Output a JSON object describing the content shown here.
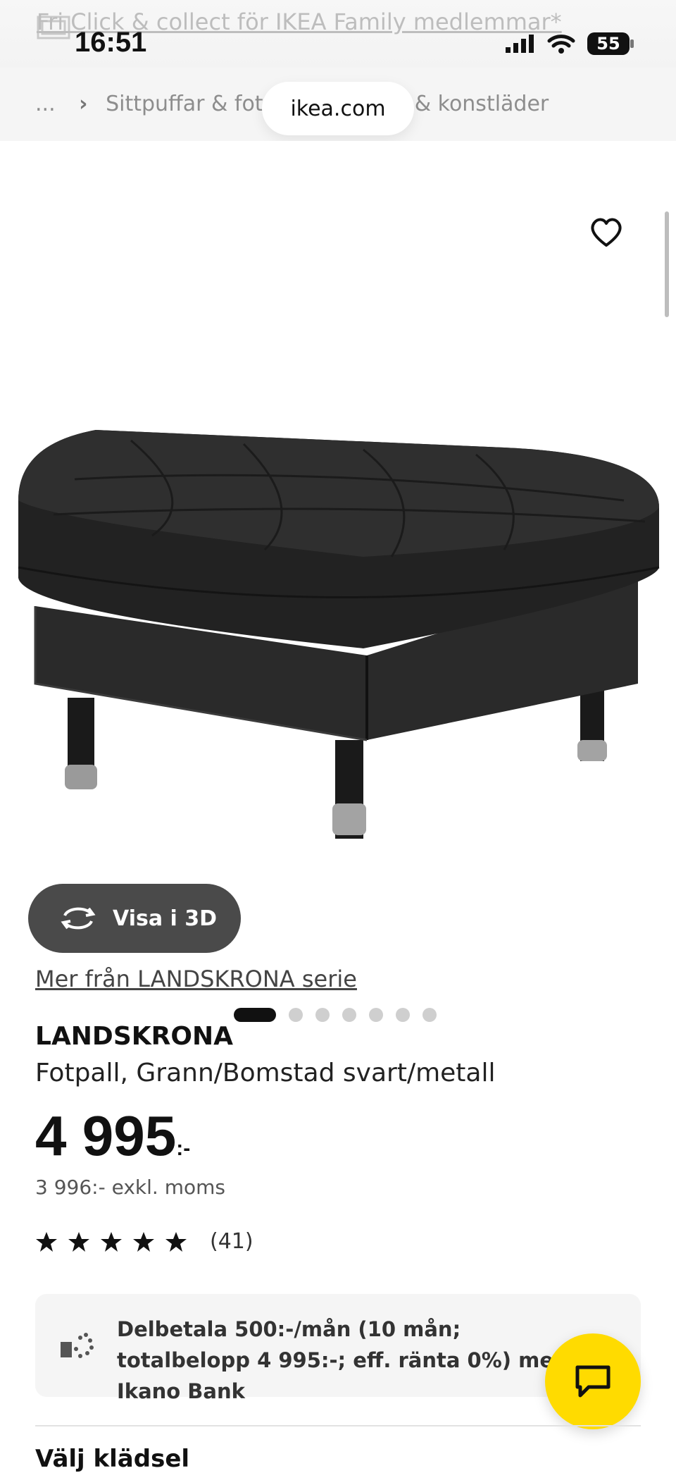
{
  "status_bar": {
    "time": "16:51",
    "battery": "55"
  },
  "promo": {
    "text": "Fri Click & collect för IKEA Family medlemmar*"
  },
  "browser": {
    "url": "ikea.com"
  },
  "breadcrumb": {
    "ellipsis": "...",
    "parent": "Sittpuffar & fotpallar",
    "current": "i skinn & konstläder"
  },
  "hero": {
    "view3d_label": "Visa i 3D",
    "image_count": 7,
    "active_index": 0
  },
  "product": {
    "series_link": "Mer från LANDSKRONA serie",
    "name": "LANDSKRONA",
    "description": "Fotpall, Grann/Bomstad svart/metall",
    "price_main": "4 995",
    "price_suffix": ":-",
    "price_excl": "3 996:- exkl. moms",
    "rating_stars": 5,
    "review_count": "(41)"
  },
  "financing": {
    "text": "Delbetala 500:-/mån (10 mån; totalbelopp 4 995:-; eff. ränta 0%) med Ikano Bank"
  },
  "next_section": {
    "heading": "Välj klädsel"
  },
  "colors": {
    "accent": "#ffdb00",
    "dark": "#111111"
  }
}
